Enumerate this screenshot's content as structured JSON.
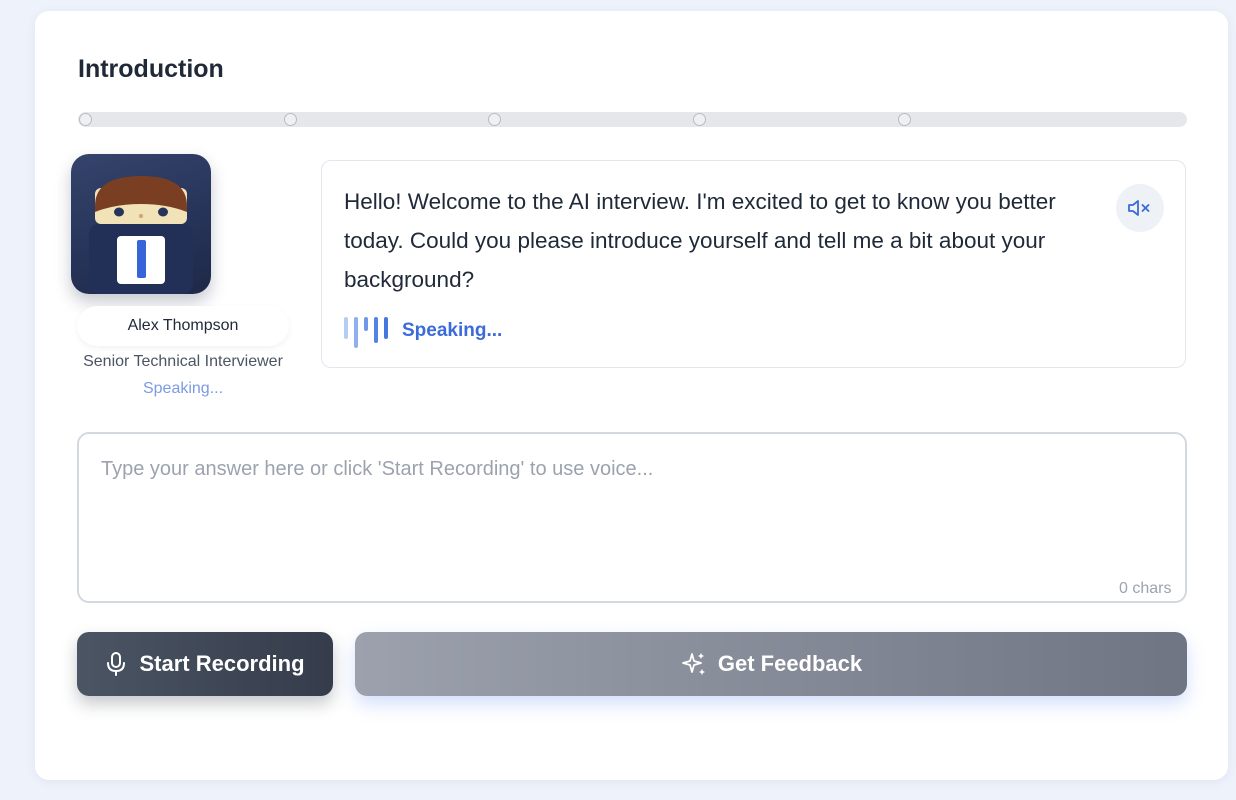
{
  "section": {
    "title": "Introduction"
  },
  "progress": {
    "steps_total": 5,
    "colors": {
      "track": "#e5e7eb",
      "dot": "#eef0f3"
    }
  },
  "interviewer": {
    "name": "Alex Thompson",
    "role": "Senior Technical Interviewer",
    "status": "Speaking..."
  },
  "question": {
    "text": "Hello! Welcome to the AI interview. I'm excited to get to know you better today. Could you please introduce yourself and tell me a bit about your background?",
    "speaking_label": "Speaking...",
    "mute_icon": "speaker-muted-icon"
  },
  "answer": {
    "value": "",
    "placeholder": "Type your answer here or click 'Start Recording' to use voice...",
    "char_count": "0 chars"
  },
  "actions": {
    "record_label": "Start Recording",
    "record_icon": "microphone-icon",
    "feedback_label": "Get Feedback",
    "feedback_icon": "sparkles-icon"
  },
  "colors": {
    "accent": "#3b6bd9",
    "text": "#1f2937",
    "record_button": "#4b5563",
    "feedback_button": "#868b98"
  }
}
